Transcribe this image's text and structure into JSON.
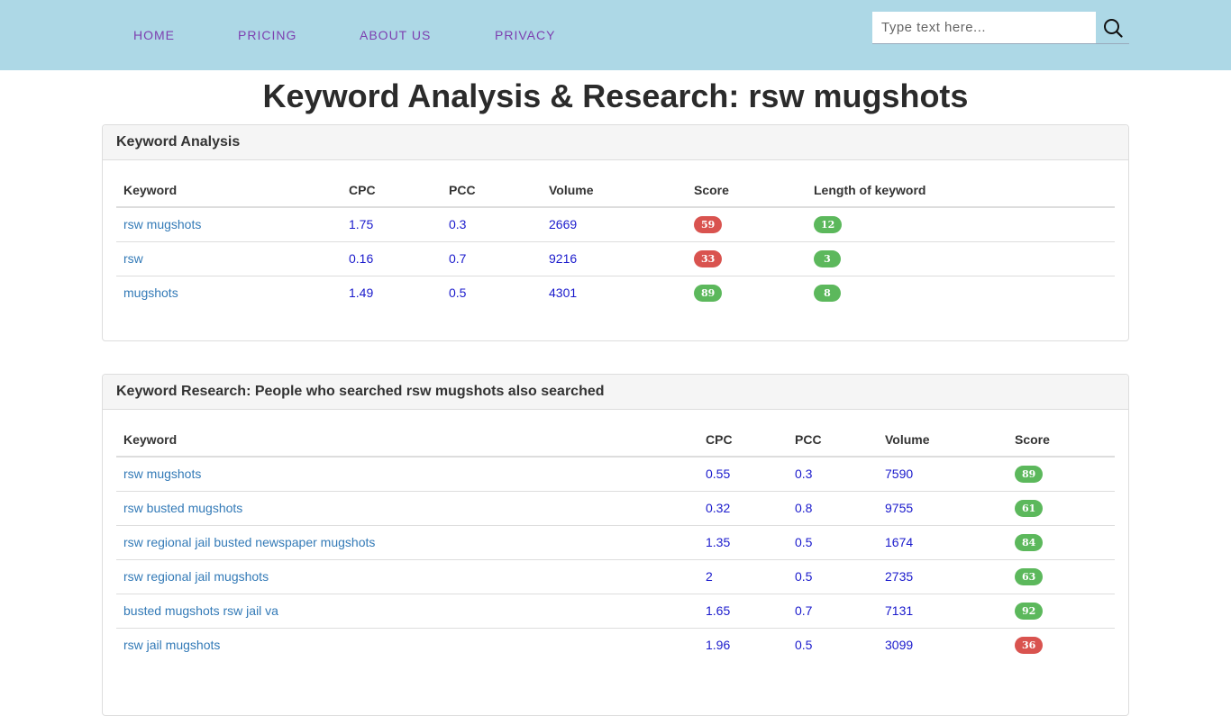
{
  "nav": {
    "items": [
      "HOME",
      "PRICING",
      "ABOUT US",
      "PRIVACY"
    ]
  },
  "search": {
    "placeholder": "Type text here...",
    "icon": "search-icon"
  },
  "page_title": "Keyword Analysis & Research: rsw mugshots",
  "analysis": {
    "title": "Keyword Analysis",
    "headers": [
      "Keyword",
      "CPC",
      "PCC",
      "Volume",
      "Score",
      "Length of keyword"
    ],
    "rows": [
      {
        "keyword": "rsw mugshots",
        "cpc": "1.75",
        "pcc": "0.3",
        "volume": "2669",
        "score": "59",
        "score_color": "#d9534f",
        "length": "12",
        "length_color": "#5cb85c"
      },
      {
        "keyword": "rsw",
        "cpc": "0.16",
        "pcc": "0.7",
        "volume": "9216",
        "score": "33",
        "score_color": "#d9534f",
        "length": "3",
        "length_color": "#5cb85c"
      },
      {
        "keyword": "mugshots",
        "cpc": "1.49",
        "pcc": "0.5",
        "volume": "4301",
        "score": "89",
        "score_color": "#5cb85c",
        "length": "8",
        "length_color": "#5cb85c"
      }
    ]
  },
  "research": {
    "title": "Keyword Research: People who searched rsw mugshots also searched",
    "headers": [
      "Keyword",
      "CPC",
      "PCC",
      "Volume",
      "Score"
    ],
    "rows": [
      {
        "keyword": "rsw mugshots",
        "cpc": "0.55",
        "pcc": "0.3",
        "volume": "7590",
        "score": "89",
        "score_color": "#5cb85c"
      },
      {
        "keyword": "rsw busted mugshots",
        "cpc": "0.32",
        "pcc": "0.8",
        "volume": "9755",
        "score": "61",
        "score_color": "#5cb85c"
      },
      {
        "keyword": "rsw regional jail busted newspaper mugshots",
        "cpc": "1.35",
        "pcc": "0.5",
        "volume": "1674",
        "score": "84",
        "score_color": "#5cb85c"
      },
      {
        "keyword": "rsw regional jail mugshots",
        "cpc": "2",
        "pcc": "0.5",
        "volume": "2735",
        "score": "63",
        "score_color": "#5cb85c"
      },
      {
        "keyword": "busted mugshots rsw jail va",
        "cpc": "1.65",
        "pcc": "0.7",
        "volume": "7131",
        "score": "92",
        "score_color": "#5cb85c"
      },
      {
        "keyword": "rsw jail mugshots",
        "cpc": "1.96",
        "pcc": "0.5",
        "volume": "3099",
        "score": "36",
        "score_color": "#d9534f"
      }
    ]
  }
}
